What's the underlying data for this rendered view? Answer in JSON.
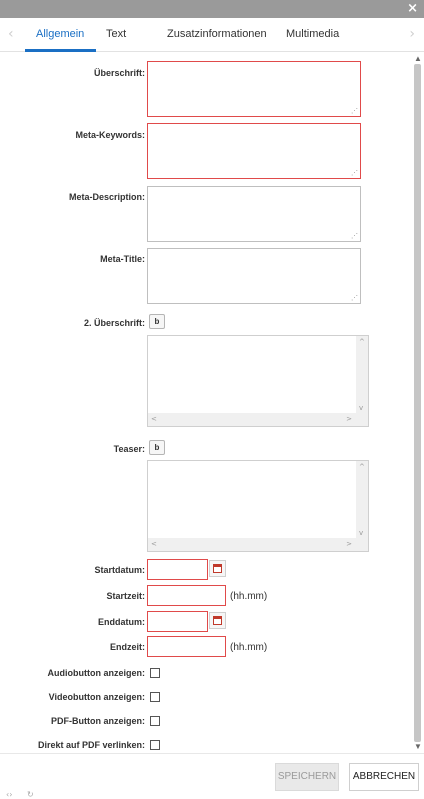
{
  "dialog": {
    "close_symbol": "×"
  },
  "tabs": {
    "prev_symbol": "‹",
    "next_symbol": "›",
    "items": [
      {
        "label": "Allgemein",
        "active": true
      },
      {
        "label": "Text"
      },
      {
        "label": "Zusatzinformationen"
      },
      {
        "label": "Multimedia"
      }
    ]
  },
  "form": {
    "ueberschrift_label": "Überschrift:",
    "meta_keywords_label": "Meta-Keywords:",
    "meta_description_label": "Meta-Description:",
    "meta_title_label": "Meta-Title:",
    "ueberschrift2_label": "2. Überschrift:",
    "teaser_label": "Teaser:",
    "editor_source_symbol": "b",
    "startdatum_label": "Startdatum:",
    "startzeit_label": "Startzeit:",
    "enddatum_label": "Enddatum:",
    "endzeit_label": "Endzeit:",
    "time_hint": "(hh.mm)",
    "audiobutton_label": "Audiobutton anzeigen:",
    "videobutton_label": "Videobutton anzeigen:",
    "pdfbutton_label": "PDF-Button anzeigen:",
    "pdf_link_label": "Direkt auf PDF verlinken:"
  },
  "footer": {
    "save_label": "SPEICHERN",
    "cancel_label": "ABBRECHEN",
    "code_symbol": "‹›",
    "refresh_symbol": "↻"
  },
  "colors": {
    "accent": "#1a6fc4",
    "required_border": "#e04a4a",
    "titlebar": "#9a9a9a"
  }
}
